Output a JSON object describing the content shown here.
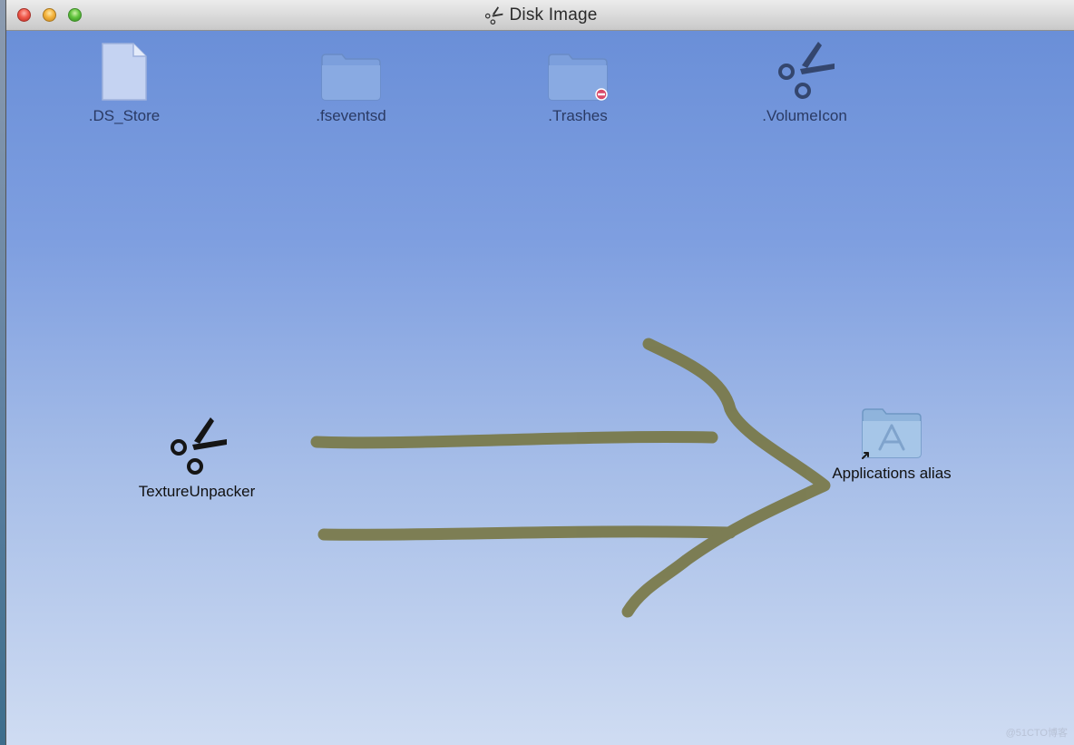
{
  "window": {
    "title": "Disk Image",
    "title_icon": "scissors-icon"
  },
  "files": [
    {
      "name": ".DS_Store",
      "icon": "document-icon"
    },
    {
      "name": ".fseventsd",
      "icon": "folder-icon"
    },
    {
      "name": ".Trashes",
      "icon": "folder-restricted-icon"
    },
    {
      "name": ".VolumeIcon",
      "icon": "scissors-icon"
    }
  ],
  "app": {
    "name": "TextureUnpacker",
    "icon": "scissors-icon"
  },
  "alias": {
    "name": "Applications alias",
    "icon": "applications-folder-alias-icon"
  },
  "drag_hint": {
    "icon": "hand-drawn-arrow-icon",
    "color": "#7a7a4c"
  },
  "colors": {
    "background_top": "#6a8fd8",
    "background_bottom": "#cfdcf2"
  },
  "watermark": "@51CTO博客"
}
